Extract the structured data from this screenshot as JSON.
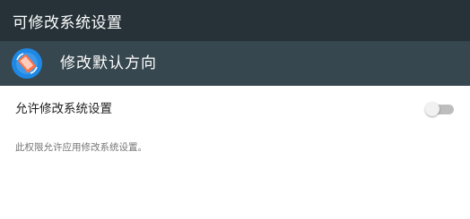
{
  "titlebar": {
    "title": "可修改系统设置"
  },
  "app": {
    "name": "修改默认方向",
    "icon": "rotation-app-icon"
  },
  "setting": {
    "label": "允许修改系统设置",
    "toggle_enabled": false,
    "description": "此权限允许应用修改系统设置。"
  },
  "colors": {
    "titlebar_bg": "#263238",
    "appbar_bg": "#37474f",
    "app_icon_bg": "#1e88e5",
    "toggle_off_track": "#bdbdbd"
  }
}
